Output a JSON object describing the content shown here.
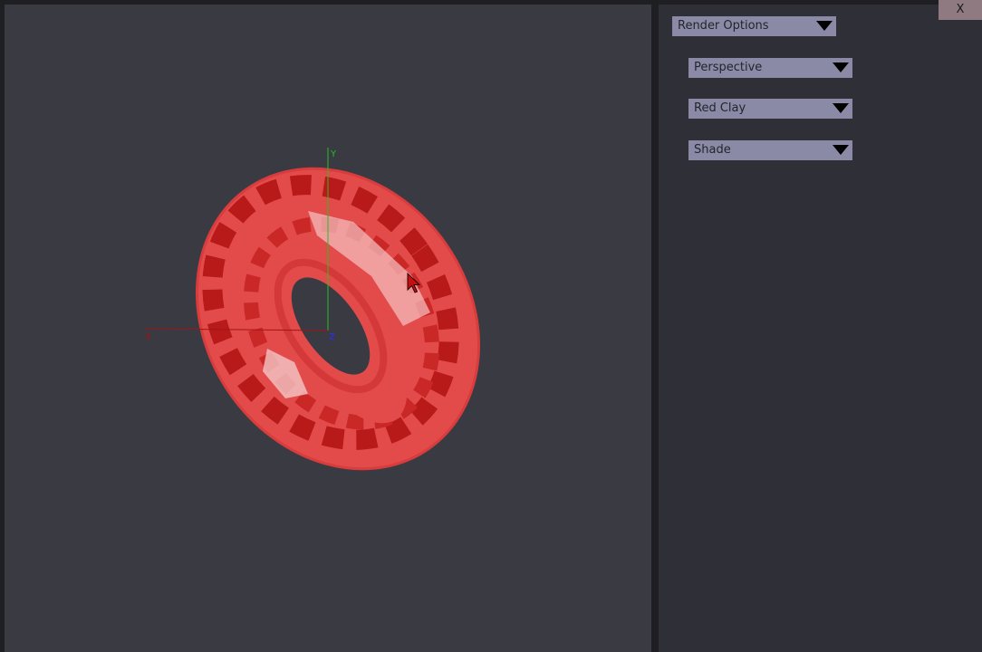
{
  "window": {
    "close_label": "X"
  },
  "panel": {
    "render_options": {
      "label": "Render Options"
    },
    "camera": {
      "label": "Perspective"
    },
    "material": {
      "label": "Red Clay"
    },
    "mode": {
      "label": "Shade"
    }
  },
  "viewport": {
    "axes": {
      "x_label": "X",
      "y_label": "Y",
      "z_label": "Z"
    },
    "object_color": "#e34b4b",
    "object_dark": "#b31414",
    "background": "#393a42"
  },
  "colors": {
    "dropdown_bg": "#8a8aa6",
    "close_bg": "#8e7a80",
    "panel_bg": "#2e2f37"
  }
}
